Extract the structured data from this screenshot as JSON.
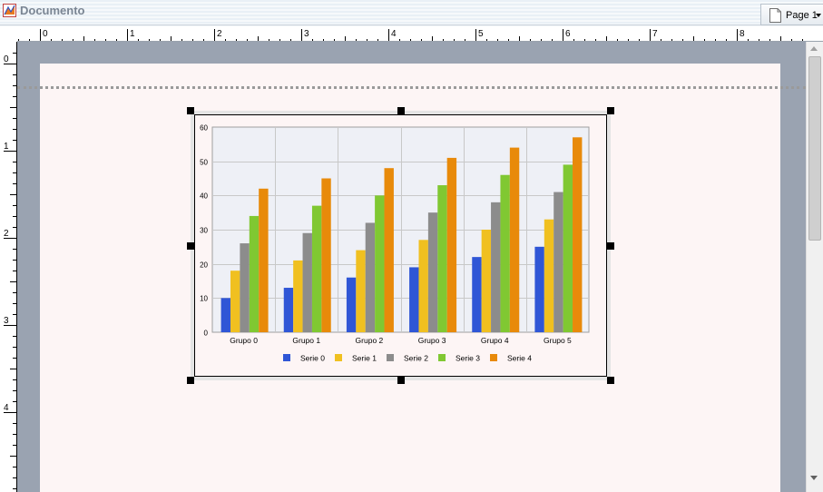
{
  "window": {
    "title": "Documento"
  },
  "toolbar": {
    "page_label": "Page 1"
  },
  "ruler": {
    "horizontal_labels": [
      "0",
      "1",
      "2",
      "3",
      "4",
      "5",
      "6",
      "7",
      "8"
    ],
    "vertical_labels": [
      "0",
      "1",
      "2",
      "3",
      "4"
    ]
  },
  "colors": {
    "series": [
      "#2f56d6",
      "#f0c020",
      "#8c8c8c",
      "#80c832",
      "#e88a0a"
    ],
    "plot_background": "#eef0f6",
    "gridline": "#c8c8c8",
    "canvas": "#9aa3b1",
    "paper": "#fdf5f5"
  },
  "chart_data": {
    "type": "bar",
    "categories": [
      "Grupo 0",
      "Grupo 1",
      "Grupo 2",
      "Grupo 3",
      "Grupo 4",
      "Grupo 5"
    ],
    "series": [
      {
        "name": "Serie 0",
        "values": [
          10,
          13,
          16,
          19,
          22,
          25
        ]
      },
      {
        "name": "Serie 1",
        "values": [
          18,
          21,
          24,
          27,
          30,
          33
        ]
      },
      {
        "name": "Serie 2",
        "values": [
          26,
          29,
          32,
          35,
          38,
          41
        ]
      },
      {
        "name": "Serie 3",
        "values": [
          34,
          37,
          40,
          43,
          46,
          49
        ]
      },
      {
        "name": "Serie 4",
        "values": [
          42,
          45,
          48,
          51,
          54,
          57
        ]
      }
    ],
    "y_ticks": [
      "0",
      "10",
      "20",
      "30",
      "40",
      "50",
      "60"
    ],
    "ylim": [
      0,
      60
    ],
    "grid": true,
    "legend_position": "bottom"
  }
}
